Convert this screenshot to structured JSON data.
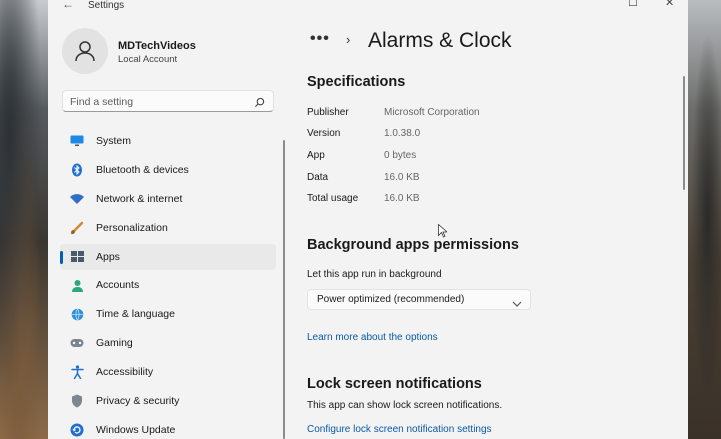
{
  "window": {
    "title": "Settings"
  },
  "profile": {
    "name": "MDTechVideos",
    "account": "Local Account"
  },
  "search": {
    "placeholder": "Find a setting"
  },
  "sidebar": {
    "items": [
      {
        "label": "System",
        "icon": "monitor-icon",
        "active": false
      },
      {
        "label": "Bluetooth & devices",
        "icon": "bluetooth-icon",
        "active": false
      },
      {
        "label": "Network & internet",
        "icon": "wifi-icon",
        "active": false
      },
      {
        "label": "Personalization",
        "icon": "brush-icon",
        "active": false
      },
      {
        "label": "Apps",
        "icon": "apps-icon",
        "active": true
      },
      {
        "label": "Accounts",
        "icon": "person-icon",
        "active": false
      },
      {
        "label": "Time & language",
        "icon": "globe-clock-icon",
        "active": false
      },
      {
        "label": "Gaming",
        "icon": "gamepad-icon",
        "active": false
      },
      {
        "label": "Accessibility",
        "icon": "accessibility-icon",
        "active": false
      },
      {
        "label": "Privacy & security",
        "icon": "shield-icon",
        "active": false
      },
      {
        "label": "Windows Update",
        "icon": "update-icon",
        "active": false
      }
    ]
  },
  "breadcrumb": {
    "overflow": "•••",
    "separator": "›",
    "title": "Alarms & Clock"
  },
  "specifications": {
    "heading": "Specifications",
    "rows": [
      {
        "label": "Publisher",
        "value": "Microsoft Corporation"
      },
      {
        "label": "Version",
        "value": "1.0.38.0"
      },
      {
        "label": "App",
        "value": "0 bytes"
      },
      {
        "label": "Data",
        "value": "16.0 KB"
      },
      {
        "label": "Total usage",
        "value": "16.0 KB"
      }
    ]
  },
  "background": {
    "heading": "Background apps permissions",
    "label": "Let this app run in background",
    "selected": "Power optimized (recommended)",
    "link": "Learn more about the options"
  },
  "lockscreen": {
    "heading": "Lock screen notifications",
    "text": "This app can show lock screen notifications.",
    "link": "Configure lock screen notification settings"
  },
  "colors": {
    "accent": "#005fb8",
    "link": "#0a5aa8",
    "window_bg": "#f3f3f3"
  }
}
